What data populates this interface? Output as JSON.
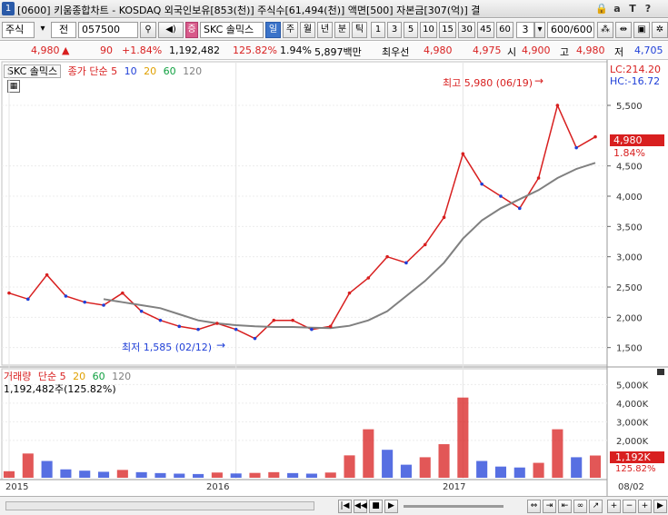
{
  "titlebar": {
    "window_number": "1",
    "title": "[0600] 키움종합차트 - KOSDAQ 외국인보유[853(천)] 주식수[61,494(천)] 액면[500] 자본금[307(억)] 결",
    "icons": [
      "lock-icon",
      "text-size-icon",
      "font-icon",
      "help-icon"
    ]
  },
  "toolbar": {
    "market_label": "주식",
    "prev_label": "전",
    "code": "057500",
    "stock_name": "SKC 솔믹스",
    "period_buttons": [
      "일",
      "주",
      "월",
      "년",
      "분",
      "틱"
    ],
    "active_period": "일",
    "minute_options": [
      "1",
      "3",
      "5",
      "10",
      "15",
      "30",
      "45",
      "60"
    ],
    "spin_value": "3",
    "count": "600/600"
  },
  "quote": {
    "price": "4,980",
    "change": "90",
    "change_pct": "+1.84%",
    "volume": "1,192,482",
    "volume_ratio": "125.82%",
    "turnover": "1.94%",
    "amount": "5,897백만",
    "best_bid_label": "최우선",
    "ask": "4,980",
    "bid": "4,975",
    "open_label": "시",
    "open": "4,900",
    "high_label": "고",
    "high": "4,980",
    "low_label": "저",
    "low": "4,705"
  },
  "price_chart": {
    "stock_label": "SKC 솔믹스",
    "indicator_label": "종가 단순",
    "ma_periods": [
      "5",
      "10",
      "20",
      "60",
      "120"
    ],
    "lc_label": "LC:214.20",
    "hc_label": "HC:-16.72",
    "current_price": "4,980",
    "current_change": "1.84%",
    "high_annotation": "최고 5,980 (06/19)",
    "low_annotation": "최저 1,585 (02/12)"
  },
  "volume_chart": {
    "label": "거래량",
    "indicator_label": "단순",
    "ma_periods": [
      "5",
      "20",
      "60",
      "120"
    ],
    "value_label": "1,192,482주(125.82%)",
    "current_volume": "1,192K",
    "current_ratio": "125.82%"
  },
  "x_axis": {
    "labels": [
      "2015",
      "2016",
      "2017",
      "08/02"
    ]
  },
  "colors": {
    "up": "#d81f1f",
    "down": "#1f3fd8",
    "ma5": "#d81f1f",
    "ma10": "#1f3fd8",
    "ma20": "#e0a000",
    "ma60": "#10a040",
    "ma120": "#808080"
  },
  "chart_data": [
    {
      "type": "line",
      "title": "SKC 솔믹스",
      "xlabel": "",
      "ylabel": "",
      "x": [
        "2015-01",
        "2015-02",
        "2015-03",
        "2015-04",
        "2015-05",
        "2015-06",
        "2015-07",
        "2015-08",
        "2015-09",
        "2015-10",
        "2015-11",
        "2015-12",
        "2016-01",
        "2016-02",
        "2016-03",
        "2016-04",
        "2016-05",
        "2016-06",
        "2016-07",
        "2016-08",
        "2016-09",
        "2016-10",
        "2016-11",
        "2016-12",
        "2017-01",
        "2017-02",
        "2017-03",
        "2017-04",
        "2017-05",
        "2017-06",
        "2017-07",
        "2017-08"
      ],
      "series": [
        {
          "name": "종가",
          "values": [
            2400,
            2300,
            2700,
            2350,
            2250,
            2200,
            2400,
            2100,
            1950,
            1850,
            1800,
            1900,
            1800,
            1650,
            1950,
            1950,
            1800,
            1850,
            2400,
            2650,
            3000,
            2900,
            3200,
            3650,
            4700,
            4200,
            4000,
            3800,
            4300,
            5500,
            4800,
            4980
          ]
        },
        {
          "name": "120",
          "values": [
            null,
            null,
            null,
            null,
            null,
            2300,
            2250,
            2200,
            2150,
            2050,
            1950,
            1900,
            1870,
            1850,
            1840,
            1840,
            1830,
            1820,
            1860,
            1950,
            2100,
            2350,
            2600,
            2900,
            3300,
            3600,
            3800,
            3950,
            4100,
            4300,
            4450,
            4550
          ]
        }
      ],
      "ylim": [
        1300,
        6100
      ],
      "y_ticks": [
        "1,500",
        "2,000",
        "2,500",
        "3,000",
        "3,500",
        "4,000",
        "4,500",
        "5,500"
      ],
      "annotations": [
        "최고 5,980 (06/19)",
        "최저 1,585 (02/12)"
      ]
    },
    {
      "type": "bar",
      "title": "거래량",
      "xlabel": "",
      "ylabel": "",
      "categories": [
        "2015-01",
        "2015-02",
        "2015-03",
        "2015-04",
        "2015-05",
        "2015-06",
        "2015-07",
        "2015-08",
        "2015-09",
        "2015-10",
        "2015-11",
        "2015-12",
        "2016-01",
        "2016-02",
        "2016-03",
        "2016-04",
        "2016-05",
        "2016-06",
        "2016-07",
        "2016-08",
        "2016-09",
        "2016-10",
        "2016-11",
        "2016-12",
        "2017-01",
        "2017-02",
        "2017-03",
        "2017-04",
        "2017-05",
        "2017-06",
        "2017-07",
        "2017-08"
      ],
      "values": [
        350,
        1300,
        900,
        450,
        380,
        320,
        420,
        300,
        250,
        220,
        200,
        280,
        230,
        260,
        300,
        250,
        220,
        280,
        1200,
        2600,
        1500,
        700,
        1100,
        1800,
        4300,
        900,
        600,
        550,
        800,
        2600,
        1100,
        1192
      ],
      "ylim": [
        0,
        5600
      ],
      "y_ticks": [
        "2,000K",
        "3,000K",
        "4,000K",
        "5,000K"
      ]
    }
  ]
}
